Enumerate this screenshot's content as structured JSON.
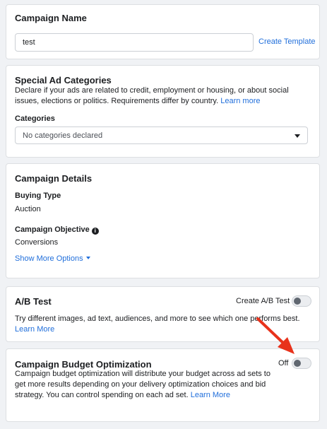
{
  "campaign_name": {
    "title": "Campaign Name",
    "input_value": "test",
    "create_template_label": "Create Template"
  },
  "special_ad_categories": {
    "title": "Special Ad Categories",
    "description": "Declare if your ads are related to credit, employment or housing, or about social issues, elections or politics. Requirements differ by country.",
    "learn_more": "Learn more",
    "categories_label": "Categories",
    "categories_value": "No categories declared"
  },
  "campaign_details": {
    "title": "Campaign Details",
    "buying_type_label": "Buying Type",
    "buying_type_value": "Auction",
    "objective_label": "Campaign Objective",
    "objective_info_icon": "i",
    "objective_value": "Conversions",
    "show_more_label": "Show More Options"
  },
  "ab_test": {
    "title": "A/B Test",
    "toggle_label": "Create A/B Test",
    "toggle_on": false,
    "description": "Try different images, ad text, audiences, and more to see which one performs best.",
    "learn_more": "Learn More"
  },
  "budget_optimization": {
    "title": "Campaign Budget Optimization",
    "toggle_state_label": "Off",
    "toggle_on": false,
    "description": "Campaign budget optimization will distribute your budget across ad sets to get more results depending on your delivery optimization choices and bid strategy. You can control spending on each ad set.",
    "learn_more": "Learn More"
  },
  "annotation": {
    "arrow_color": "#e8321b"
  }
}
